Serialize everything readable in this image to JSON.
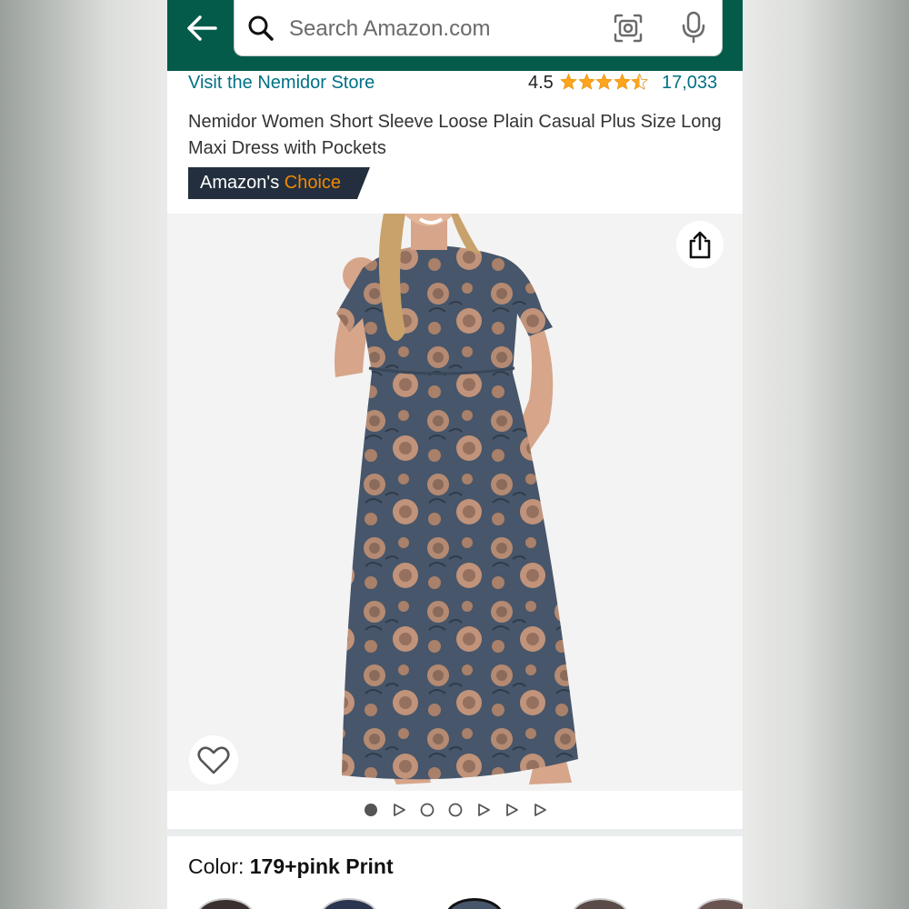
{
  "search": {
    "placeholder": "Search Amazon.com"
  },
  "product": {
    "store_link": "Visit the Nemidor Store",
    "rating": "4.5",
    "rating_count": "17,033",
    "title": "Nemidor Women Short Sleeve Loose Plain Casual Plus Size Long Maxi Dress with Pockets",
    "badge_prefix": "Amazon's",
    "badge_accent": "Choice",
    "stars": 4.5
  },
  "carousel": {
    "items": [
      "dot-filled",
      "play",
      "dot",
      "dot",
      "play",
      "play",
      "play"
    ],
    "active_index": 0
  },
  "color": {
    "label": "Color:",
    "value": "179+pink Print"
  },
  "colors": {
    "header_bg": "#045b4a",
    "link": "#007185",
    "star": "#ffa41c",
    "badge_bg": "#232f3e",
    "badge_accent": "#f08804"
  },
  "icons": {
    "back": "arrow-left-icon",
    "search": "search-icon",
    "camera": "camera-icon",
    "mic": "microphone-icon",
    "share": "share-icon",
    "wishlist": "heart-icon"
  }
}
